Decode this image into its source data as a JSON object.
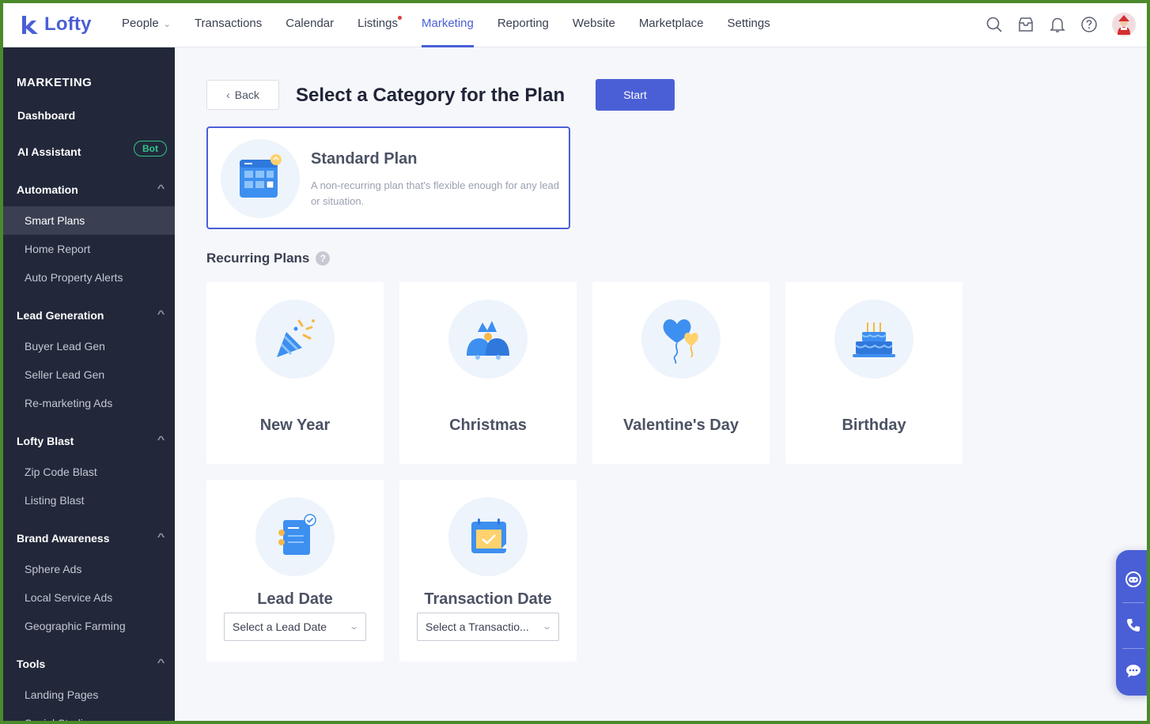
{
  "brand": {
    "name": "Lofty",
    "accent": "#4a5fd6"
  },
  "topnav": {
    "items": [
      {
        "label": "People",
        "has_caret": true
      },
      {
        "label": "Transactions"
      },
      {
        "label": "Calendar"
      },
      {
        "label": "Listings",
        "has_dot": true
      },
      {
        "label": "Marketing",
        "active": true
      },
      {
        "label": "Reporting"
      },
      {
        "label": "Website"
      },
      {
        "label": "Marketplace"
      },
      {
        "label": "Settings"
      }
    ],
    "icons": [
      "search-icon",
      "inbox-icon",
      "bell-icon",
      "help-icon",
      "avatar"
    ]
  },
  "sidebar": {
    "title": "MARKETING",
    "dashboard": "Dashboard",
    "ai_assistant": "AI Assistant",
    "bot_badge": "Bot",
    "sections": [
      {
        "label": "Automation",
        "items": [
          "Smart Plans",
          "Home Report",
          "Auto Property Alerts"
        ]
      },
      {
        "label": "Lead Generation",
        "items": [
          "Buyer Lead Gen",
          "Seller Lead Gen",
          "Re-marketing Ads"
        ]
      },
      {
        "label": "Lofty Blast",
        "items": [
          "Zip Code Blast",
          "Listing Blast"
        ]
      },
      {
        "label": "Brand Awareness",
        "items": [
          "Sphere Ads",
          "Local Service Ads",
          "Geographic Farming"
        ]
      },
      {
        "label": "Tools",
        "items": [
          "Landing Pages",
          "Social Studio"
        ]
      }
    ],
    "active_item": "Smart Plans"
  },
  "main": {
    "back_label": "Back",
    "title": "Select a Category for the Plan",
    "start_label": "Start",
    "standard": {
      "title": "Standard Plan",
      "description": "A non-recurring plan that's flexible enough for any lead or situation."
    },
    "recurring_title": "Recurring Plans",
    "recurring_help": "?",
    "cards": [
      {
        "label": "New Year",
        "icon": "party-popper-icon"
      },
      {
        "label": "Christmas",
        "icon": "christmas-bells-icon"
      },
      {
        "label": "Valentine's Day",
        "icon": "heart-balloons-icon"
      },
      {
        "label": "Birthday",
        "icon": "birthday-cake-icon"
      },
      {
        "label": "Lead Date",
        "icon": "document-check-icon",
        "select_placeholder": "Select a Lead Date"
      },
      {
        "label": "Transaction Date",
        "icon": "calendar-check-icon",
        "select_placeholder": "Select a Transactio..."
      }
    ]
  },
  "widget": {
    "icons": [
      "chat-bot-icon",
      "phone-icon",
      "message-icon"
    ]
  }
}
